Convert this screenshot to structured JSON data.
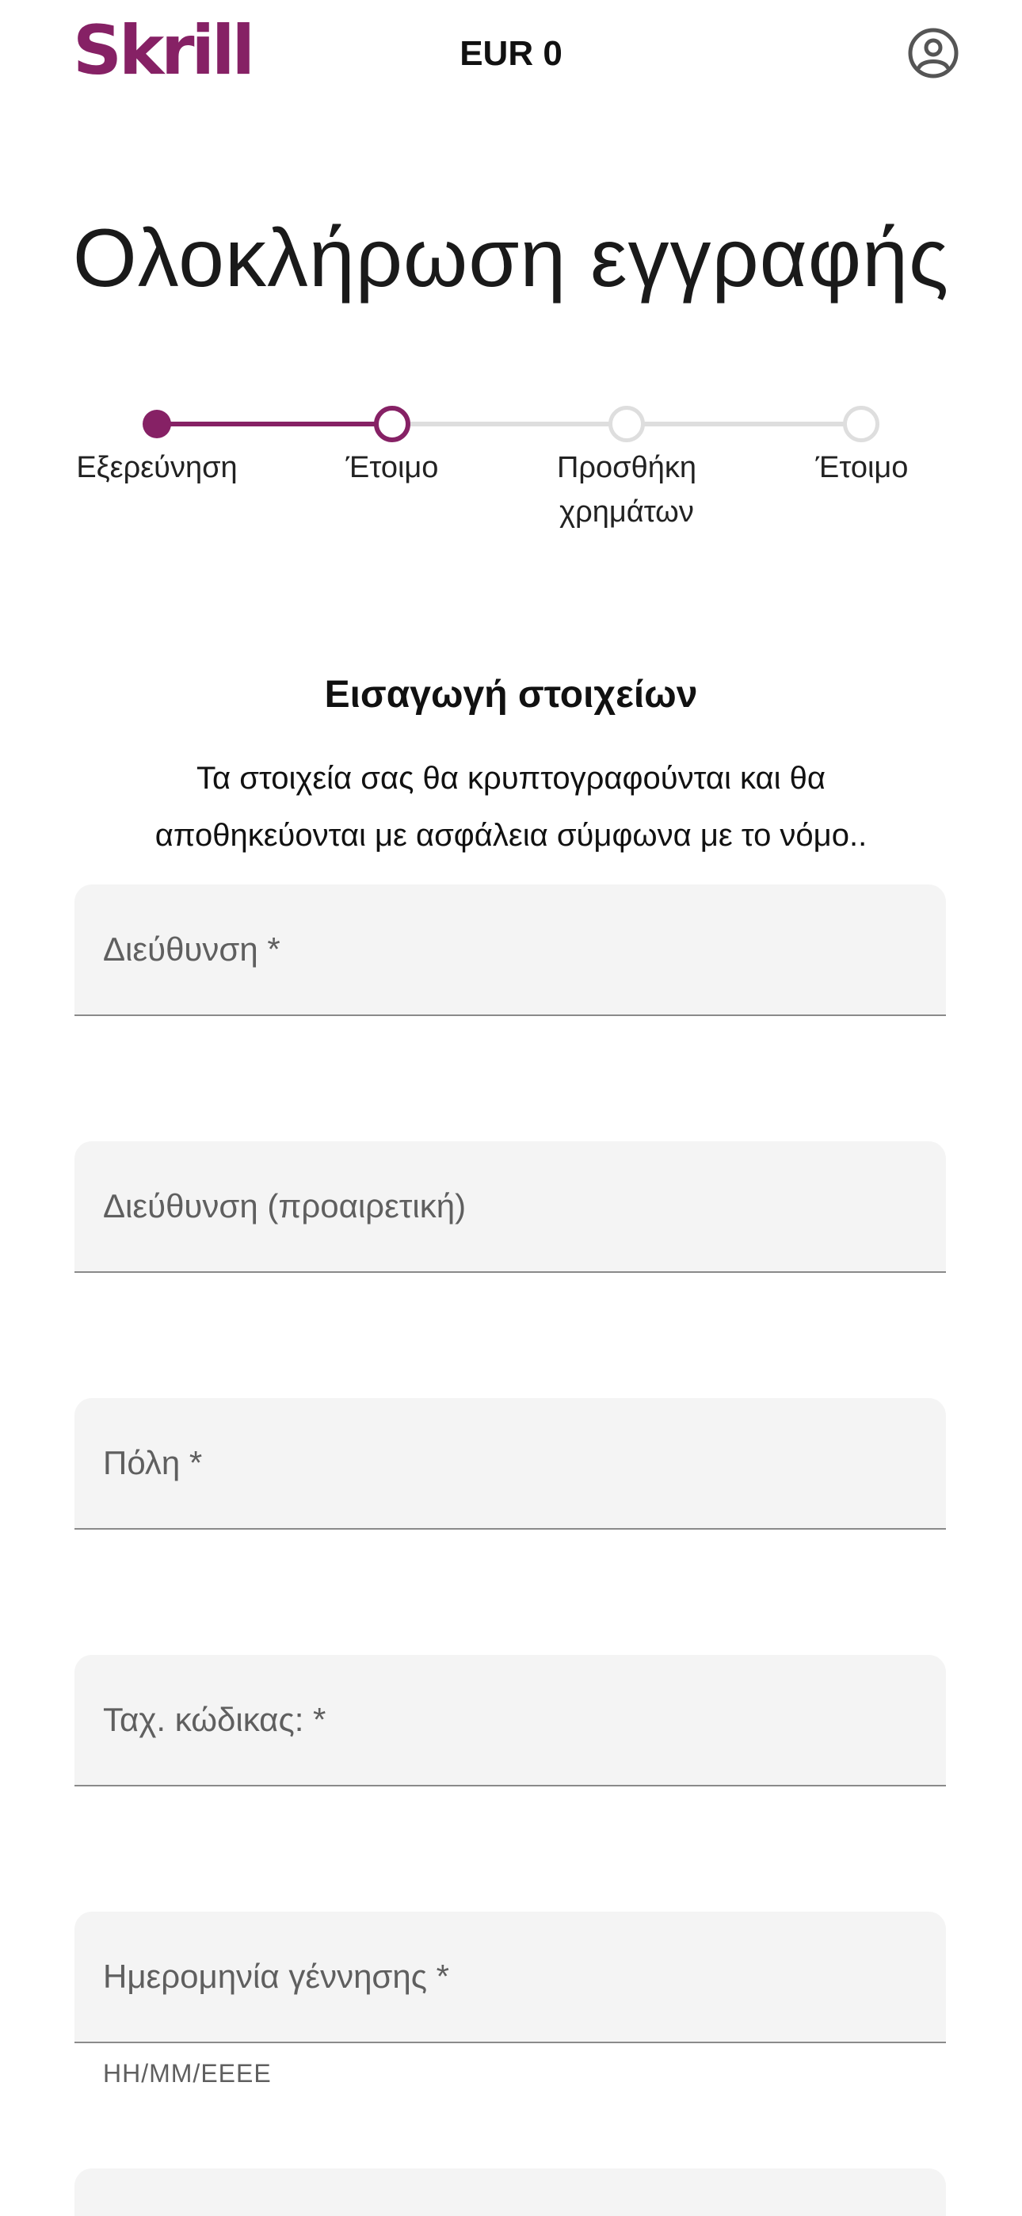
{
  "header": {
    "brand": "Skrill",
    "balance": "EUR 0",
    "account_icon": "user-circle-icon"
  },
  "page_title": "Ολοκλήρωση εγγραφής",
  "stepper": {
    "steps": [
      {
        "label": "Εξερεύνηση",
        "state": "complete"
      },
      {
        "label": "Έτοιμο",
        "state": "current"
      },
      {
        "label": "Προσθήκη χρημάτων",
        "state": "upcoming"
      },
      {
        "label": "Έτοιμο",
        "state": "upcoming"
      }
    ],
    "accent_color": "#862165",
    "inactive_color": "#dedede"
  },
  "section": {
    "title": "Εισαγωγή στοιχείων",
    "description": "Τα στοιχεία σας θα κρυπτογραφούνται και θα αποθηκεύονται με ασφάλεια σύμφωνα με το νόμο.."
  },
  "form": {
    "address_label": "Διεύθυνση *",
    "address2_label": "Διεύθυνση (προαιρετική)",
    "city_label": "Πόλη *",
    "postcode_label": "Ταχ. κώδικας: *",
    "dob_label": "Ημερομηνία γέννησης *",
    "dob_helper": "ΗΗ/ΜΜ/ΕΕΕΕ"
  },
  "colors": {
    "brand": "#862165",
    "field_bg": "#f4f4f4",
    "field_border": "#8a8a8a"
  }
}
